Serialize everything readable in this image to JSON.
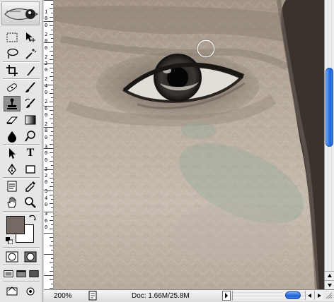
{
  "window": {
    "title": ""
  },
  "toolbox": {
    "tools": [
      {
        "name": "marquee-tool",
        "icon": "dashed-rect-icon",
        "active": false
      },
      {
        "name": "move-tool",
        "icon": "move-arrow-icon",
        "active": false
      },
      {
        "name": "lasso-tool",
        "icon": "lasso-icon",
        "active": false
      },
      {
        "name": "magic-wand-tool",
        "icon": "magic-wand-icon",
        "active": false
      },
      {
        "name": "crop-tool",
        "icon": "crop-icon",
        "active": false
      },
      {
        "name": "slice-tool",
        "icon": "slice-knife-icon",
        "active": false
      },
      {
        "name": "healing-brush-tool",
        "icon": "bandage-icon",
        "active": false
      },
      {
        "name": "brush-tool",
        "icon": "brush-icon",
        "active": false
      },
      {
        "name": "clone-stamp-tool",
        "icon": "stamp-icon",
        "active": true
      },
      {
        "name": "history-brush-tool",
        "icon": "history-brush-icon",
        "active": false
      },
      {
        "name": "eraser-tool",
        "icon": "eraser-icon",
        "active": false
      },
      {
        "name": "gradient-tool",
        "icon": "gradient-icon",
        "active": false
      },
      {
        "name": "blur-tool",
        "icon": "drop-icon",
        "active": false
      },
      {
        "name": "dodge-tool",
        "icon": "dodge-icon",
        "active": false
      },
      {
        "name": "path-selection-tool",
        "icon": "arrow-pointer-icon",
        "active": false
      },
      {
        "name": "type-tool",
        "icon": "type-t-icon",
        "active": false
      },
      {
        "name": "pen-tool",
        "icon": "pen-nib-icon",
        "active": false
      },
      {
        "name": "shape-tool",
        "icon": "rectangle-icon",
        "active": false
      },
      {
        "name": "notes-tool",
        "icon": "note-icon",
        "active": false
      },
      {
        "name": "eyedropper-tool",
        "icon": "eyedropper-icon",
        "active": false
      },
      {
        "name": "hand-tool",
        "icon": "hand-icon",
        "active": false
      },
      {
        "name": "zoom-tool",
        "icon": "magnifier-icon",
        "active": false
      }
    ],
    "type_label": "T",
    "colors": {
      "foreground": "#746a63",
      "background": "#ffffff"
    }
  },
  "ruler": {
    "labels": [
      "1",
      "8",
      "0",
      "2",
      "0",
      "0",
      "2",
      "2",
      "0",
      "2",
      "4",
      "0",
      "2",
      "6",
      "0",
      "2",
      "8",
      "0",
      "3",
      "0",
      "0",
      "3",
      "2",
      "0",
      "3",
      "4",
      "0",
      "3",
      "6",
      "0"
    ]
  },
  "status": {
    "zoom": "200%",
    "doc": "Doc: 1.66M/25.8M"
  },
  "colors": {
    "accent": "#1f62d6"
  }
}
